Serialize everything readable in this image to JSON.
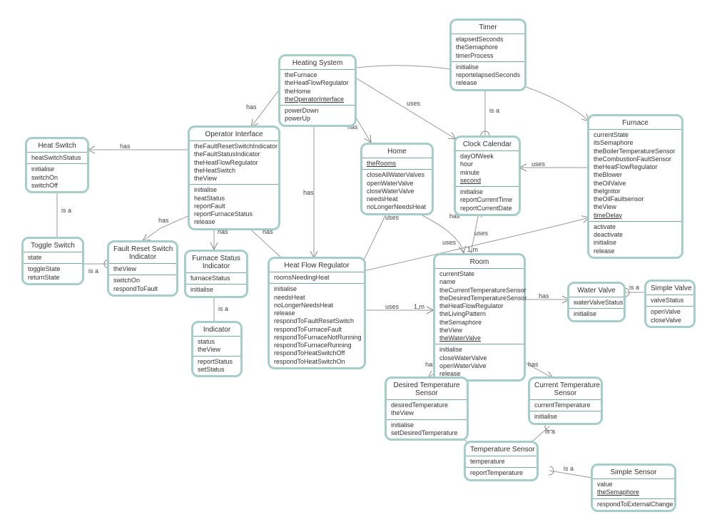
{
  "labels": {
    "has": "has",
    "isa": "is a",
    "uses": "uses",
    "m1": "1,m"
  },
  "nodes": {
    "heatSwitch": {
      "title": "Heat Switch",
      "attrs": [
        "heatSwitchStatus"
      ],
      "ops": [
        "initialise",
        "switchOn",
        "switchOff"
      ]
    },
    "toggleSwitch": {
      "title": "Toggle Switch",
      "attrs": [
        "state"
      ],
      "ops": [
        "toggleState",
        "returnState"
      ]
    },
    "faultResetSwitchIndicator": {
      "title": "Fault Reset Switch Indicator",
      "title2": "",
      "attrs": [
        "theView"
      ],
      "ops": [
        "switchOn",
        "respondToFault"
      ]
    },
    "operatorInterface": {
      "title": "Operator Interface",
      "attrs": [
        "theFaultResetSwitchIndicator",
        "theFaultStatusIndicator",
        "theHeatFlowRegulator",
        "theHeatSwitch",
        "theView"
      ],
      "ops": [
        "initialise",
        "heatStatus",
        "reportFault",
        "reportFurnaceStatus",
        "release"
      ]
    },
    "furnaceStatusIndicator": {
      "title": "Furnace Status Indicator",
      "title2": "",
      "attrs": [
        "furnaceStatus"
      ],
      "ops": [
        "initialise"
      ]
    },
    "indicator": {
      "title": "Indicator",
      "attrs": [
        "status",
        "theView"
      ],
      "ops": [
        "reportStatus",
        "setStatus"
      ]
    },
    "heatingSystem": {
      "title": "Heating System",
      "attrs": [
        "theFurnace",
        "theHeatFlowRegulator",
        "theHome",
        {
          "t": "theOperatorInterface",
          "u": true
        }
      ],
      "ops": [
        "powerDown",
        "powerUp"
      ]
    },
    "home": {
      "title": "Home",
      "attrs": [
        {
          "t": "theRooms",
          "u": true
        }
      ],
      "ops": [
        "closeAllWaterValves",
        "openWaterValve",
        "closeWaterValve",
        "needsHeat",
        "noLongerNeedsHeat"
      ]
    },
    "timer": {
      "title": "Timer",
      "attrs": [
        "elapsedSeconds",
        "theSemaphore",
        "timerProcess"
      ],
      "ops": [
        "initialise",
        "reportelapsedSeconds",
        "release"
      ]
    },
    "clockCalendar": {
      "title": "Clock Calendar",
      "attrs": [
        "dayOfWeek",
        "hour",
        "minute",
        {
          "t": "second",
          "u": true
        }
      ],
      "ops": [
        "initialise",
        "reportCurrentTime",
        "reportCurrentDate"
      ]
    },
    "furnace": {
      "title": "Furnace",
      "attrs": [
        "currentState",
        "itsSemaphore",
        "theBoilerTemperatureSensor",
        "theCombustionFaultSensor",
        "theHeatFlowRegulator",
        "theBlower",
        "theOilValve",
        "theIgnitor",
        "theOilFaultsensor",
        "theView",
        {
          "t": "timeDelay",
          "u": true
        }
      ],
      "ops": [
        "activate",
        "deactivate",
        "initialise",
        "release"
      ]
    },
    "heatFlowRegulator": {
      "title": "Heat Flow Regulator",
      "attrs": [
        "roomsNeedingHeat"
      ],
      "ops": [
        "initialise",
        "needsHeat",
        "noLongerNeedsHeat",
        "release",
        "respondToFaultResetSwitch",
        "respondToFurnaceFault",
        "respondToFurnaceNotRunning",
        "respondToFurnaceRunning",
        "respondToHeatSwitchOff",
        "respondToHeatSwitchOn"
      ]
    },
    "room": {
      "title": "Room",
      "attrs": [
        "currentState",
        "name",
        "theCurrentTemperatureSensor",
        "theDesiredTemperatureSensor",
        "theHeatFlowRegulator",
        "theLivingPattern",
        "theSemaphore",
        "theView",
        {
          "t": "theWaterValve",
          "u": true
        }
      ],
      "ops": [
        "initialise",
        "closeWaterValve",
        "openWaterValve",
        "release"
      ]
    },
    "waterValve": {
      "title": "Water Valve",
      "attrs": [
        "waterValveStatus"
      ],
      "ops": [
        "initialise"
      ]
    },
    "simpleValve": {
      "title": "Simple Valve",
      "attrs": [
        "valveStatus"
      ],
      "ops": [
        "openValve",
        "closeValve"
      ]
    },
    "desiredTempSensor": {
      "title": "Desired Temperature Sensor",
      "title2": "",
      "attrs": [
        "desiredTemperature",
        "theView"
      ],
      "ops": [
        "initialise",
        "setDesiredTemperature"
      ]
    },
    "currentTempSensor": {
      "title": "Current Temperature Sensor",
      "title2": "",
      "attrs": [
        "currentTemperature"
      ],
      "ops": [
        "initialise"
      ]
    },
    "temperatureSensor": {
      "title": "Temperature Sensor",
      "attrs": [
        "temperature"
      ],
      "ops": [
        "reportTemperature"
      ]
    },
    "simpleSensor": {
      "title": "Simple Sensor",
      "attrs": [
        "value",
        {
          "t": "theSemaphore",
          "u": true
        }
      ],
      "ops": [
        "respondToExternalChange"
      ]
    }
  },
  "chart_data": {
    "type": "class-diagram",
    "title": "",
    "classes": [
      {
        "id": "heatSwitch",
        "name": "Heat Switch",
        "attributes": [
          "heatSwitchStatus"
        ],
        "operations": [
          "initialise",
          "switchOn",
          "switchOff"
        ]
      },
      {
        "id": "toggleSwitch",
        "name": "Toggle Switch",
        "attributes": [
          "state"
        ],
        "operations": [
          "toggleState",
          "returnState"
        ]
      },
      {
        "id": "faultResetSwitchIndicator",
        "name": "Fault Reset Switch Indicator",
        "attributes": [
          "theView"
        ],
        "operations": [
          "switchOn",
          "respondToFault"
        ]
      },
      {
        "id": "operatorInterface",
        "name": "Operator Interface",
        "attributes": [
          "theFaultResetSwitchIndicator",
          "theFaultStatusIndicator",
          "theHeatFlowRegulator",
          "theHeatSwitch",
          "theView"
        ],
        "operations": [
          "initialise",
          "heatStatus",
          "reportFault",
          "reportFurnaceStatus",
          "release"
        ]
      },
      {
        "id": "furnaceStatusIndicator",
        "name": "Furnace Status Indicator",
        "attributes": [
          "furnaceStatus"
        ],
        "operations": [
          "initialise"
        ]
      },
      {
        "id": "indicator",
        "name": "Indicator",
        "attributes": [
          "status",
          "theView"
        ],
        "operations": [
          "reportStatus",
          "setStatus"
        ]
      },
      {
        "id": "heatingSystem",
        "name": "Heating System",
        "attributes": [
          "theFurnace",
          "theHeatFlowRegulator",
          "theHome",
          "theOperatorInterface"
        ],
        "operations": [
          "powerDown",
          "powerUp"
        ]
      },
      {
        "id": "home",
        "name": "Home",
        "attributes": [
          "theRooms"
        ],
        "operations": [
          "closeAllWaterValves",
          "openWaterValve",
          "closeWaterValve",
          "needsHeat",
          "noLongerNeedsHeat"
        ]
      },
      {
        "id": "timer",
        "name": "Timer",
        "attributes": [
          "elapsedSeconds",
          "theSemaphore",
          "timerProcess"
        ],
        "operations": [
          "initialise",
          "reportelapsedSeconds",
          "release"
        ]
      },
      {
        "id": "clockCalendar",
        "name": "Clock Calendar",
        "attributes": [
          "dayOfWeek",
          "hour",
          "minute",
          "second"
        ],
        "operations": [
          "initialise",
          "reportCurrentTime",
          "reportCurrentDate"
        ]
      },
      {
        "id": "furnace",
        "name": "Furnace",
        "attributes": [
          "currentState",
          "itsSemaphore",
          "theBoilerTemperatureSensor",
          "theCombustionFaultSensor",
          "theHeatFlowRegulator",
          "theBlower",
          "theOilValve",
          "theIgnitor",
          "theOilFaultsensor",
          "theView",
          "timeDelay"
        ],
        "operations": [
          "activate",
          "deactivate",
          "initialise",
          "release"
        ]
      },
      {
        "id": "heatFlowRegulator",
        "name": "Heat Flow Regulator",
        "attributes": [
          "roomsNeedingHeat"
        ],
        "operations": [
          "initialise",
          "needsHeat",
          "noLongerNeedsHeat",
          "release",
          "respondToFaultResetSwitch",
          "respondToFurnaceFault",
          "respondToFurnaceNotRunning",
          "respondToFurnaceRunning",
          "respondToHeatSwitchOff",
          "respondToHeatSwitchOn"
        ]
      },
      {
        "id": "room",
        "name": "Room",
        "attributes": [
          "currentState",
          "name",
          "theCurrentTemperatureSensor",
          "theDesiredTemperatureSensor",
          "theHeatFlowRegulator",
          "theLivingPattern",
          "theSemaphore",
          "theView",
          "theWaterValve"
        ],
        "operations": [
          "initialise",
          "closeWaterValve",
          "openWaterValve",
          "release"
        ]
      },
      {
        "id": "waterValve",
        "name": "Water Valve",
        "attributes": [
          "waterValveStatus"
        ],
        "operations": [
          "initialise"
        ]
      },
      {
        "id": "simpleValve",
        "name": "Simple Valve",
        "attributes": [
          "valveStatus"
        ],
        "operations": [
          "openValve",
          "closeValve"
        ]
      },
      {
        "id": "desiredTempSensor",
        "name": "Desired Temperature Sensor",
        "attributes": [
          "desiredTemperature",
          "theView"
        ],
        "operations": [
          "initialise",
          "setDesiredTemperature"
        ]
      },
      {
        "id": "currentTempSensor",
        "name": "Current Temperature Sensor",
        "attributes": [
          "currentTemperature"
        ],
        "operations": [
          "initialise"
        ]
      },
      {
        "id": "temperatureSensor",
        "name": "Temperature Sensor",
        "attributes": [
          "temperature"
        ],
        "operations": [
          "reportTemperature"
        ]
      },
      {
        "id": "simpleSensor",
        "name": "Simple Sensor",
        "attributes": [
          "value",
          "theSemaphore"
        ],
        "operations": [
          "respondToExternalChange"
        ]
      }
    ],
    "relations": [
      {
        "from": "operatorInterface",
        "to": "heatSwitch",
        "type": "has"
      },
      {
        "from": "heatSwitch",
        "to": "toggleSwitch",
        "type": "is a"
      },
      {
        "from": "faultResetSwitchIndicator",
        "to": "toggleSwitch",
        "type": "is a"
      },
      {
        "from": "operatorInterface",
        "to": "faultResetSwitchIndicator",
        "type": "has"
      },
      {
        "from": "operatorInterface",
        "to": "furnaceStatusIndicator",
        "type": "has"
      },
      {
        "from": "furnaceStatusIndicator",
        "to": "indicator",
        "type": "is a"
      },
      {
        "from": "heatingSystem",
        "to": "operatorInterface",
        "type": "has"
      },
      {
        "from": "heatingSystem",
        "to": "heatFlowRegulator",
        "type": "has"
      },
      {
        "from": "heatingSystem",
        "to": "home",
        "type": "has"
      },
      {
        "from": "heatingSystem",
        "to": "furnace",
        "type": "has"
      },
      {
        "from": "heatingSystem",
        "to": "clockCalendar",
        "type": "uses"
      },
      {
        "from": "clockCalendar",
        "to": "timer",
        "type": "is a"
      },
      {
        "from": "furnace",
        "to": "clockCalendar",
        "type": "uses"
      },
      {
        "from": "home",
        "to": "room",
        "type": "has",
        "multiplicity": "1,m"
      },
      {
        "from": "heatFlowRegulator",
        "to": "operatorInterface",
        "type": "has"
      },
      {
        "from": "heatFlowRegulator",
        "to": "home",
        "type": "uses"
      },
      {
        "from": "heatFlowRegulator",
        "to": "furnace",
        "type": "uses"
      },
      {
        "from": "heatFlowRegulator",
        "to": "room",
        "type": "uses",
        "multiplicity": "1,m"
      },
      {
        "from": "room",
        "to": "clockCalendar",
        "type": "uses"
      },
      {
        "from": "room",
        "to": "waterValve",
        "type": "has"
      },
      {
        "from": "room",
        "to": "desiredTempSensor",
        "type": "has"
      },
      {
        "from": "room",
        "to": "currentTempSensor",
        "type": "has"
      },
      {
        "from": "waterValve",
        "to": "simpleValve",
        "type": "is a"
      },
      {
        "from": "desiredTempSensor",
        "to": "temperatureSensor",
        "type": "is a"
      },
      {
        "from": "currentTempSensor",
        "to": "temperatureSensor",
        "type": "is a"
      },
      {
        "from": "temperatureSensor",
        "to": "simpleSensor",
        "type": "is a"
      }
    ]
  }
}
